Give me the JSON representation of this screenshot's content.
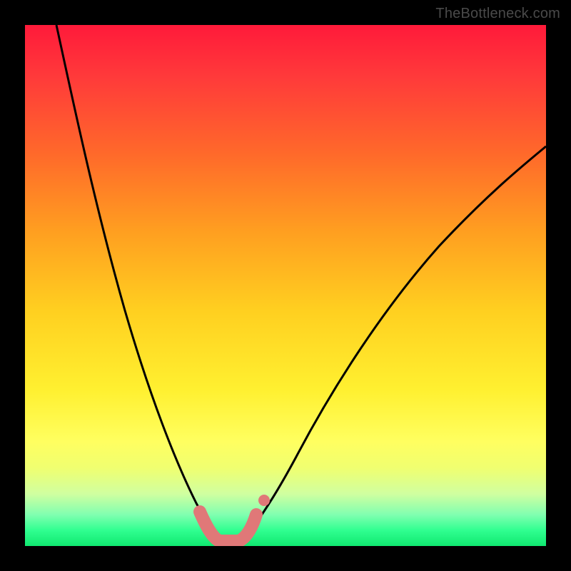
{
  "watermark": "TheBottleneck.com",
  "chart_data": {
    "type": "line",
    "title": "",
    "xlabel": "",
    "ylabel": "",
    "xlim": [
      0,
      100
    ],
    "ylim": [
      0,
      100
    ],
    "series": [
      {
        "name": "left-curve",
        "x": [
          6,
          10,
          14,
          18,
          22,
          26,
          30,
          32,
          34,
          36
        ],
        "values": [
          100,
          80,
          60,
          42,
          28,
          16,
          7,
          3,
          1,
          0
        ]
      },
      {
        "name": "right-curve",
        "x": [
          40,
          42,
          46,
          52,
          60,
          70,
          80,
          90,
          100
        ],
        "values": [
          0,
          3,
          10,
          22,
          38,
          53,
          64,
          72,
          78
        ]
      },
      {
        "name": "valley-highlight",
        "x": [
          32,
          34,
          36,
          38,
          40,
          41
        ],
        "values": [
          6,
          2,
          0,
          0,
          2,
          6
        ]
      }
    ],
    "colors": {
      "curve": "#000000",
      "highlight": "#e07878"
    },
    "gradient_stops": [
      {
        "pos": 0,
        "color": "#ff1a3a"
      },
      {
        "pos": 50,
        "color": "#ffd020"
      },
      {
        "pos": 85,
        "color": "#f0ff70"
      },
      {
        "pos": 100,
        "color": "#10e870"
      }
    ]
  }
}
